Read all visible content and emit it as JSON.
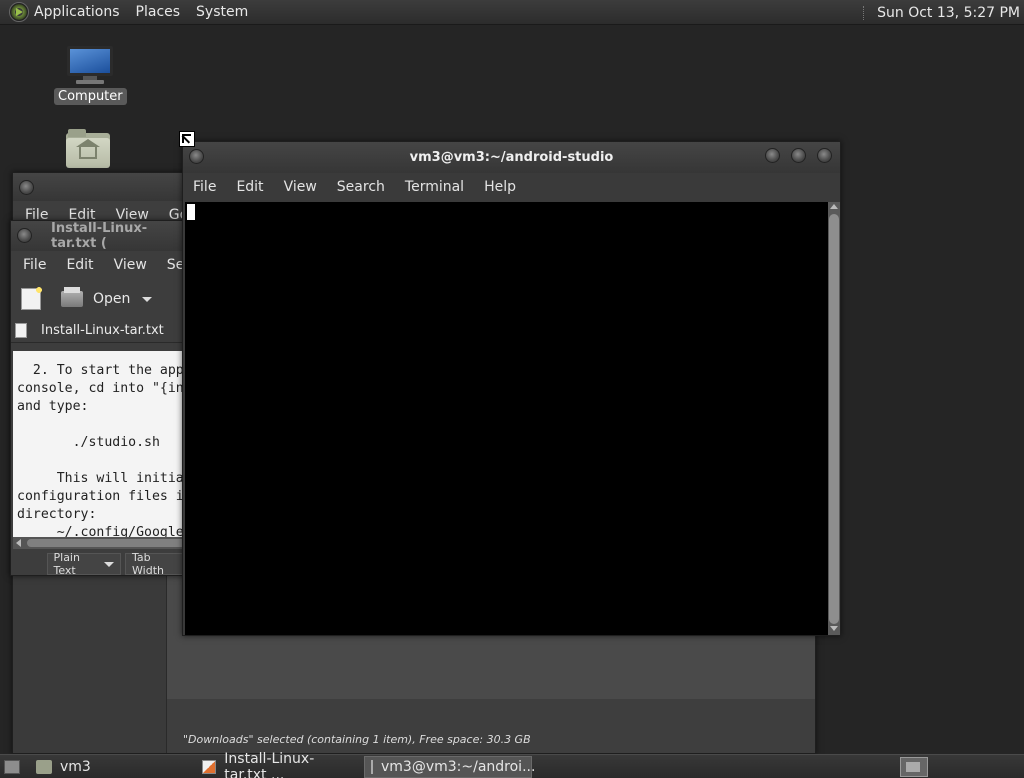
{
  "top_panel": {
    "menus": [
      "Applications",
      "Places",
      "System"
    ],
    "clock": "Sun Oct 13,  5:27 PM"
  },
  "desktop": {
    "icons": [
      {
        "label": "Computer",
        "icon": "computer-icon"
      },
      {
        "label": "",
        "icon": "home-folder-icon"
      }
    ]
  },
  "file_manager": {
    "menus": [
      "File",
      "Edit",
      "View",
      "Go"
    ],
    "status": "\"Downloads\" selected (containing 1 item), Free space: 30.3 GB"
  },
  "gedit": {
    "title": "Install-Linux-tar.txt (",
    "menus": [
      "File",
      "Edit",
      "View",
      "Sear"
    ],
    "toolbar": {
      "open_label": "Open"
    },
    "tab_label": "Install-Linux-tar.txt",
    "text": "  2. To start the app\nconsole, cd into \"{in\nand type:\n\n       ./studio.sh\n\n     This will initia\nconfiguration files i\ndirectory:\n     ~/.config/Google",
    "status": {
      "language": "Plain Text",
      "tab_width": "Tab Width"
    }
  },
  "terminal": {
    "title": "vm3@vm3:~/android-studio",
    "menus": [
      "File",
      "Edit",
      "View",
      "Search",
      "Terminal",
      "Help"
    ]
  },
  "taskbar": {
    "items": [
      {
        "label": "vm3",
        "icon": "folder-icon",
        "active": false
      },
      {
        "label": "Install-Linux-tar.txt ...",
        "icon": "text-editor-icon",
        "active": false
      },
      {
        "label": "vm3@vm3:~/androi...",
        "icon": "terminal-icon",
        "active": true
      }
    ]
  }
}
